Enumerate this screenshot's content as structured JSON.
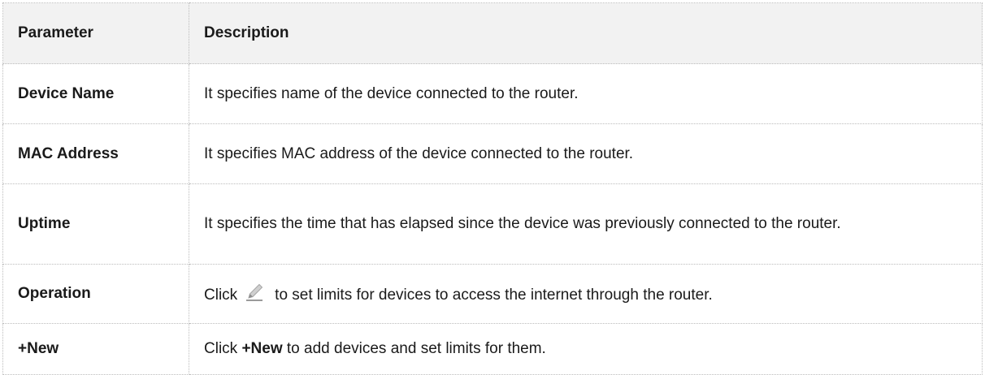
{
  "table": {
    "headers": [
      "Parameter",
      "Description"
    ],
    "rows": [
      {
        "parameter": "Device Name",
        "description": "It specifies name of the device connected to the router."
      },
      {
        "parameter": "MAC Address",
        "description": "It specifies MAC address of the device connected to the router."
      },
      {
        "parameter": "Uptime",
        "description": "It specifies the time that has elapsed since the device was previously connected to the router."
      },
      {
        "parameter": "Operation",
        "description_before": "Click",
        "icon": "edit-pencil-icon",
        "description_after": "to set limits for devices to access the internet through the router."
      },
      {
        "parameter": "+New",
        "description_before": "Click",
        "description_bold": "+New",
        "description_after": "to add devices and set limits for them."
      }
    ]
  },
  "colors": {
    "header_bg": "#f2f2f2",
    "border": "#bcbcbc",
    "icon": "#9a9a9a"
  }
}
